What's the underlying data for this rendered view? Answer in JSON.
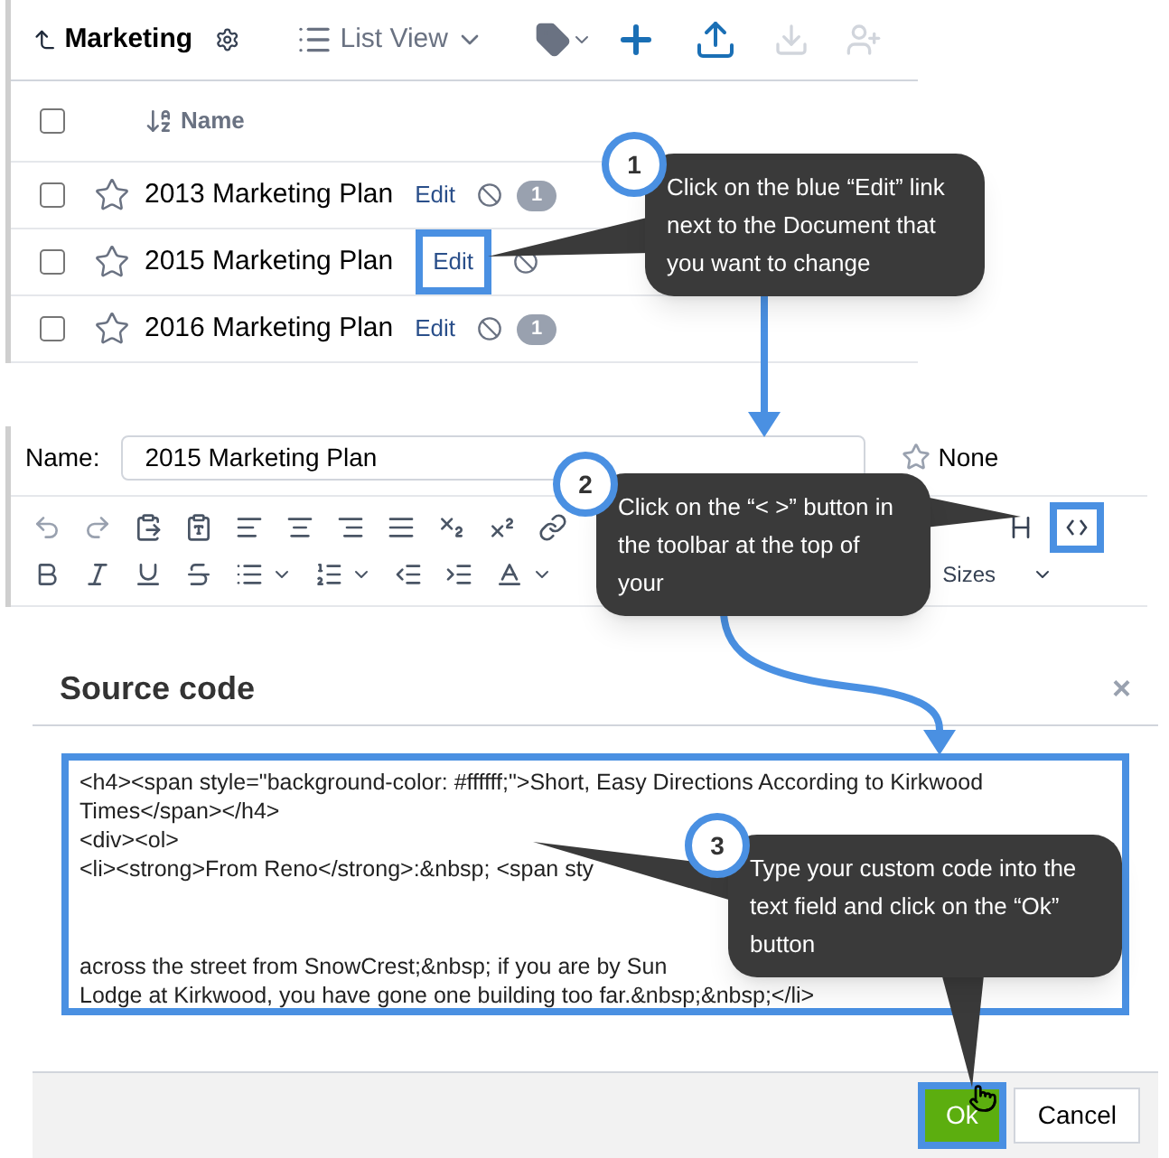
{
  "folder": {
    "name": "Marketing"
  },
  "view": {
    "label": "List View"
  },
  "list": {
    "column": "Name",
    "all_checked": false,
    "rows": [
      {
        "name": "2013 Marketing Plan",
        "edit": "Edit",
        "count": "1",
        "highlighted": false,
        "checked": false
      },
      {
        "name": "2015 Marketing Plan",
        "edit": "Edit",
        "highlighted": true,
        "checked": false
      },
      {
        "name": "2016 Marketing Plan",
        "edit": "Edit",
        "count": "1",
        "highlighted": false,
        "checked": false
      }
    ]
  },
  "editor": {
    "name_label": "Name:",
    "name_value": "2015 Marketing Plan",
    "star_label": "None",
    "sizes_label": "Sizes",
    "source_highlighted": true
  },
  "dialog": {
    "title": "Source code",
    "close": "×",
    "code_lines": [
      "<h4><span style=\"background-color: #ffffff;\">Short, Easy Directions According to Kirkwood Times</span></h4>",
      "<div><ol>",
      "<li><strong>From Reno</strong>:&nbsp; <span sty",
      "across the street from SnowCrest;&nbsp; if you are by Sun",
      "Lodge at Kirkwood, you have gone one building too far.&nbsp;&nbsp;</li>"
    ],
    "ok": "Ok",
    "cancel": "Cancel",
    "ok_highlighted": true
  },
  "callouts": [
    {
      "number": "1",
      "text": "Click  on the blue “Edit” link next to the Document that you want to change"
    },
    {
      "number": "2",
      "text": "Click on the “< >” button in the toolbar at the top of your"
    },
    {
      "number": "3",
      "text": "Type your custom code into the text field and click on the “Ok” button"
    }
  ]
}
